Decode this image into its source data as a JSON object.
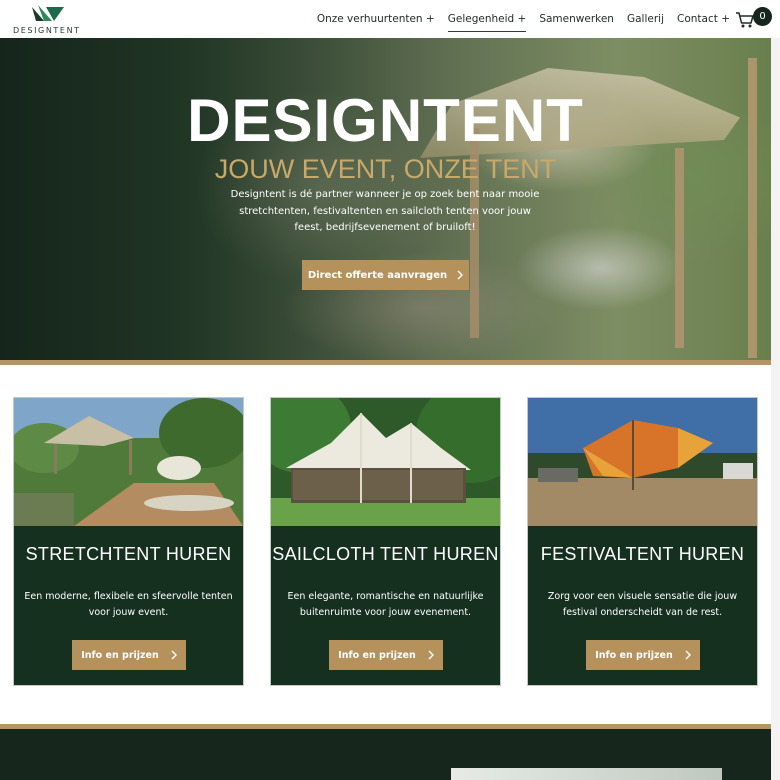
{
  "brand": {
    "logo_text": "DESIGNTENT"
  },
  "nav": {
    "items": [
      {
        "label": "Onze verhuurtenten +"
      },
      {
        "label": "Gelegenheid +"
      },
      {
        "label": "Samenwerken"
      },
      {
        "label": "Gallerij"
      },
      {
        "label": "Contact +"
      }
    ],
    "active_index": 1
  },
  "cart": {
    "count": "0"
  },
  "hero": {
    "title": "DESIGNTENT",
    "subtitle": "JOUW EVENT, ONZE TENT",
    "text": "Designtent is dé partner wanneer je op zoek bent naar mooie stretchtenten, festivaltenten en sailcloth tenten voor jouw feest, bedrijfsevenement of bruiloft!",
    "button": "Direct offerte aanvragen"
  },
  "cards": [
    {
      "title": "STRETCHTENT HUREN",
      "desc": "Een moderne, flexibele en sfeervolle tenten voor jouw event.",
      "button": "Info en prijzen"
    },
    {
      "title": "SAILCLOTH TENT HUREN",
      "desc": "Een elegante, romantische en natuurlijke buitenruimte voor jouw evenement.",
      "button": "Info en prijzen"
    },
    {
      "title": "FESTIVALTENT HUREN",
      "desc": "Zorg voor een visuele sensatie die jouw festival onderscheidt van de rest.",
      "button": "Info en prijzen"
    }
  ],
  "colors": {
    "green_dark": "#16301f",
    "gold": "#b5925c",
    "accent_logo": "#2f8a5a"
  }
}
